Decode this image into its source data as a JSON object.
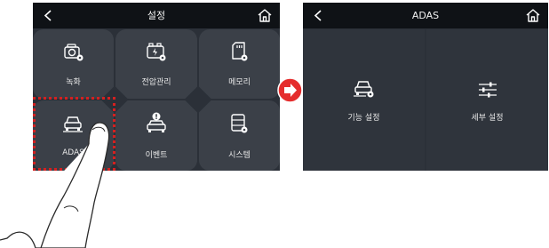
{
  "left_screen": {
    "title": "설정",
    "icons": {
      "back": "chevron-left-icon",
      "home": "home-icon"
    },
    "tiles": [
      {
        "label": "녹화",
        "icon": "dashcam-record-icon"
      },
      {
        "label": "전압관리",
        "icon": "voltage-battery-icon"
      },
      {
        "label": "메모리",
        "icon": "memory-card-icon"
      },
      {
        "label": "ADAS",
        "icon": "car-adas-icon"
      },
      {
        "label": "이벤트",
        "icon": "car-event-icon"
      },
      {
        "label": "시스템",
        "icon": "system-settings-icon"
      }
    ]
  },
  "right_screen": {
    "title": "ADAS",
    "icons": {
      "back": "chevron-left-icon",
      "home": "home-icon"
    },
    "tiles": [
      {
        "label": "기능 설정",
        "icon": "car-settings-icon"
      },
      {
        "label": "세부 설정",
        "icon": "sliders-icon"
      }
    ]
  },
  "colors": {
    "highlight": "#d42020",
    "arrow": "#e52d2d",
    "screen_bg": "#2b3038",
    "topbar": "#0f1216"
  },
  "annotations": {
    "arrow": "next-step-arrow-icon",
    "hand": "pointing-finger-icon"
  }
}
